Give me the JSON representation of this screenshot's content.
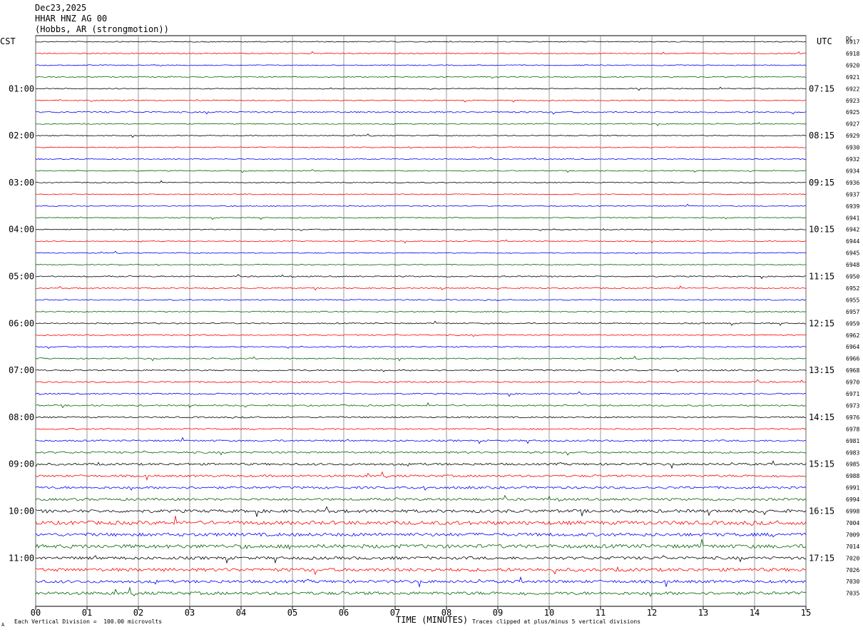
{
  "header": {
    "date": "Dec23,2025",
    "station": "HHAR HNZ AG 00",
    "location": "(Hobbs, AR (strongmotion))"
  },
  "left_zone_label": "CST",
  "right_zone_label": "UTC",
  "dc_label": "DC",
  "footer": {
    "scale_note": "Each Vertical Division =  100.00 microvolts",
    "clip_note": "Traces clipped at plus/minus 5 vertical divisions",
    "tiny_mark": "A"
  },
  "colors": {
    "trace_cycle": [
      "#000000",
      "#ff0000",
      "#0000ff",
      "#006400"
    ],
    "grid": "#808080"
  },
  "chart_data": {
    "type": "line",
    "title": "Dec23,2025 HHAR HNZ AG 00 (Hobbs, AR (strongmotion))",
    "xlabel": "TIME (MINUTES)",
    "xlim": [
      0,
      15
    ],
    "x_ticks": [
      "00",
      "01",
      "02",
      "03",
      "04",
      "05",
      "06",
      "07",
      "08",
      "09",
      "10",
      "11",
      "12",
      "13",
      "14",
      "15"
    ],
    "left_time_labels": [
      "01:00",
      "02:00",
      "03:00",
      "04:00",
      "05:00",
      "06:00",
      "07:00",
      "08:00",
      "09:00",
      "10:00",
      "11:00"
    ],
    "right_time_labels": [
      "07:15",
      "08:15",
      "09:15",
      "10:15",
      "11:15",
      "12:15",
      "13:15",
      "14:15",
      "15:15",
      "16:15",
      "17:15"
    ],
    "trace_dc_values": [
      "6917",
      "6918",
      "6920",
      "6921",
      "6922",
      "6923",
      "6925",
      "6927",
      "6929",
      "6930",
      "6932",
      "6934",
      "6936",
      "6937",
      "6939",
      "6941",
      "6942",
      "6944",
      "6945",
      "6948",
      "6950",
      "6952",
      "6955",
      "6957",
      "6959",
      "6962",
      "6964",
      "6966",
      "6968",
      "6970",
      "6971",
      "6973",
      "6976",
      "6978",
      "6981",
      "6983",
      "6985",
      "6988",
      "6991",
      "6994",
      "6998",
      "7004",
      "7009",
      "7014",
      "7020",
      "7026",
      "7030",
      "7035"
    ],
    "trace_amplitude_levels": [
      0.4,
      0.4,
      0.4,
      0.4,
      0.4,
      0.4,
      0.6,
      0.4,
      0.4,
      0.4,
      0.4,
      0.4,
      0.4,
      0.4,
      0.4,
      0.4,
      0.4,
      0.4,
      0.4,
      0.4,
      0.5,
      0.5,
      0.5,
      0.5,
      0.5,
      0.5,
      0.5,
      0.5,
      0.6,
      0.6,
      0.6,
      0.6,
      0.6,
      0.6,
      0.7,
      0.8,
      0.9,
      0.9,
      1.0,
      1.0,
      1.3,
      1.6,
      1.4,
      1.6,
      1.2,
      1.4,
      1.2,
      1.3
    ],
    "traces_per_hour": 4,
    "minutes_per_trace": 15,
    "grid": true
  }
}
